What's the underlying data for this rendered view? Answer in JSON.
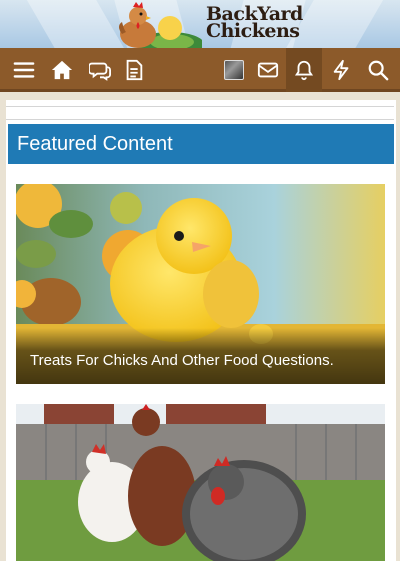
{
  "header": {
    "logo_line1": "BackYard",
    "logo_line2": "Chickens"
  },
  "nav": {
    "icons": [
      "menu-icon",
      "home-icon",
      "chat-icon",
      "document-icon",
      "avatar",
      "mail-icon",
      "bell-icon",
      "bolt-icon",
      "search-icon"
    ],
    "active": "bell-icon"
  },
  "main": {
    "section_title": "Featured Content",
    "cards": [
      {
        "caption": "Treats For Chicks And Other Food Questions."
      },
      {
        "caption": ""
      }
    ]
  },
  "colors": {
    "nav_bg": "#8c5a2a",
    "section_header": "#1f7ab5",
    "page_bg": "#e9e2d3"
  }
}
